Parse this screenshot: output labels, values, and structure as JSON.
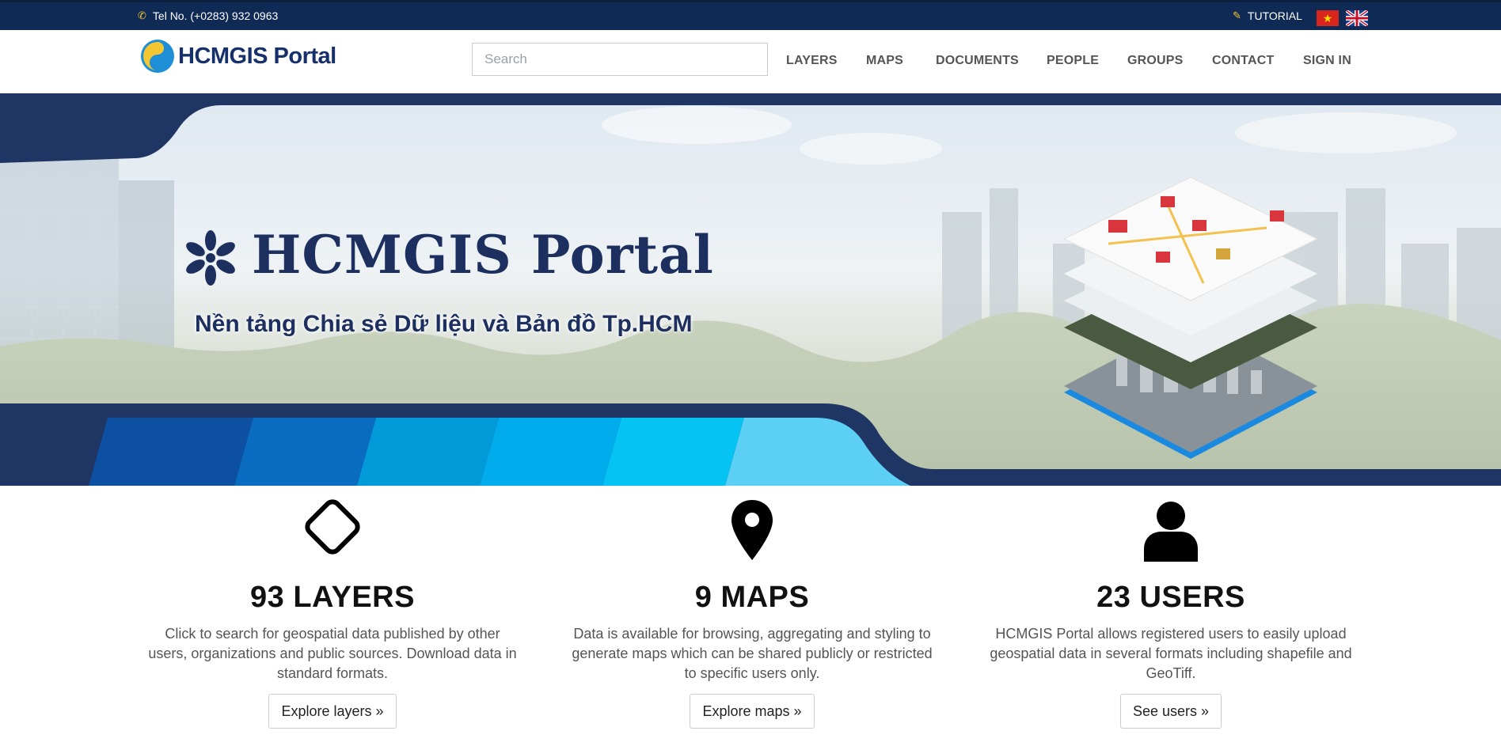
{
  "topbar": {
    "phone_text": "Tel No. (+0283) 932 0963",
    "tutorial_label": "TUTORIAL",
    "phone_icon": "phone-icon",
    "tutorial_icon": "edit-icon",
    "languages": [
      "vi",
      "en"
    ]
  },
  "navbar": {
    "brand": "HCMGIS Portal",
    "search_placeholder": "Search",
    "items": [
      "LAYERS",
      "MAPS",
      "DOCUMENTS",
      "PEOPLE",
      "GROUPS",
      "CONTACT",
      "SIGN IN"
    ]
  },
  "hero": {
    "title": "HCMGIS Portal",
    "subtitle": "Nền tảng Chia sẻ Dữ liệu và Bản đồ Tp.HCM"
  },
  "features": [
    {
      "icon": "diamond-icon",
      "heading": "93 LAYERS",
      "text": "Click to search for geospatial data published by other users, organizations and public sources. Download data in standard formats.",
      "button": "Explore layers »"
    },
    {
      "icon": "map-marker-icon",
      "heading": "9 MAPS",
      "text": "Data is available for browsing, aggregating and styling to generate maps which can be shared publicly or restricted to specific users only.",
      "button": "Explore maps »"
    },
    {
      "icon": "user-icon",
      "heading": "23 USERS",
      "text": "HCMGIS Portal allows registered users to easily upload geospatial data in several formats including shapefile and GeoTiff.",
      "button": "See users »"
    }
  ],
  "colors": {
    "navy": "#0f2a55",
    "brand_blue": "#15306b",
    "accent_yellow": "#f3c632"
  }
}
